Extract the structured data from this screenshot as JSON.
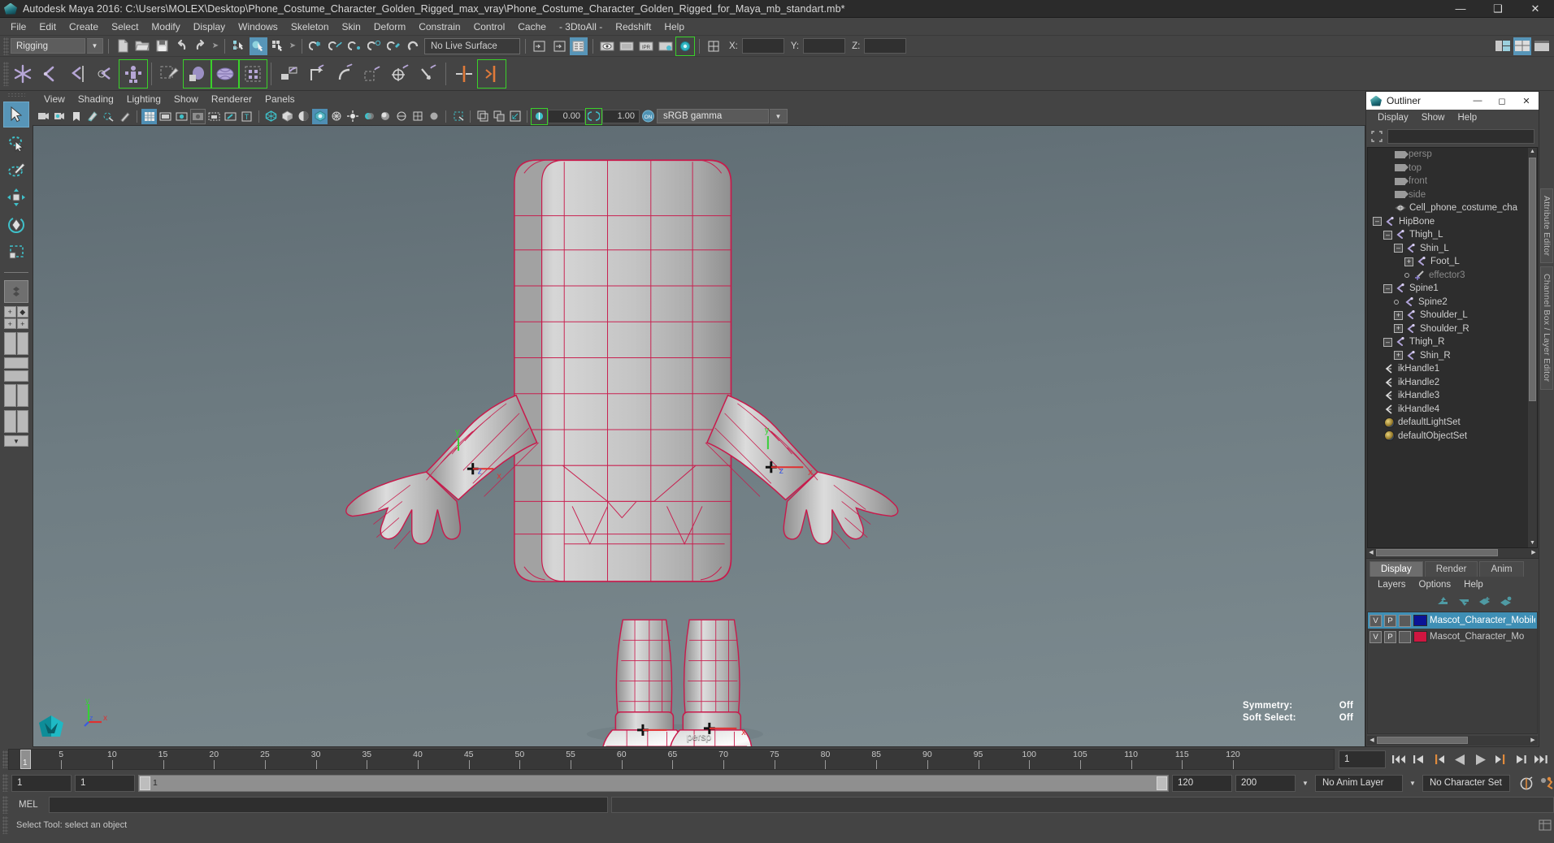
{
  "window": {
    "title": "Autodesk Maya 2016: C:\\Users\\MOLEX\\Desktop\\Phone_Costume_Character_Golden_Rigged_max_vray\\Phone_Costume_Character_Golden_Rigged_for_Maya_mb_standart.mb*",
    "minimize": "—",
    "maximize": "❑",
    "close": "✕"
  },
  "menubar": [
    "File",
    "Edit",
    "Create",
    "Select",
    "Modify",
    "Display",
    "Windows",
    "Skeleton",
    "Skin",
    "Deform",
    "Constrain",
    "Control",
    "Cache",
    "- 3DtoAll -",
    "Redshift",
    "Help"
  ],
  "statusline": {
    "menu_set": "Rigging",
    "live_surface": "No Live Surface",
    "coord_x_label": "X:",
    "coord_y_label": "Y:",
    "coord_z_label": "Z:",
    "coord_x": "",
    "coord_y": "",
    "coord_z": ""
  },
  "viewport_menu": [
    "View",
    "Shading",
    "Lighting",
    "Show",
    "Renderer",
    "Panels"
  ],
  "viewport_toolbar": {
    "exposure": "0.00",
    "gamma": "1.00",
    "color_profile": "sRGB gamma"
  },
  "viewport": {
    "camera_label": "persp",
    "hud": [
      {
        "label": "Symmetry:",
        "value": "Off"
      },
      {
        "label": "Soft Select:",
        "value": "Off"
      }
    ],
    "axis": {
      "x": "x",
      "y": "y",
      "z": "z"
    },
    "manipulator_labels": {
      "x": "x",
      "y": "y",
      "z": "z"
    },
    "colors": {
      "wireframe": "#c9194b",
      "surface": "#b9b9b9",
      "background_top": "#5e6b72",
      "background_bottom": "#7d8b90",
      "axis_x": "#e03030",
      "axis_y": "#36d036",
      "axis_z": "#3a5ae0"
    }
  },
  "outliner": {
    "title": "Outliner",
    "menus": [
      "Display",
      "Show",
      "Help"
    ],
    "search_value": "",
    "search_placeholder": "",
    "items": [
      {
        "label": "persp",
        "indent": 1,
        "icon": "camera-icon",
        "expander": "none",
        "dim": true
      },
      {
        "label": "top",
        "indent": 1,
        "icon": "camera-icon",
        "expander": "none",
        "dim": true
      },
      {
        "label": "front",
        "indent": 1,
        "icon": "camera-icon",
        "expander": "none",
        "dim": true
      },
      {
        "label": "side",
        "indent": 1,
        "icon": "camera-icon",
        "expander": "none",
        "dim": true
      },
      {
        "label": "Cell_phone_costume_cha",
        "indent": 1,
        "icon": "mesh-icon",
        "expander": "none",
        "dim": false
      },
      {
        "label": "HipBone",
        "indent": 0,
        "icon": "joint-icon",
        "expander": "minus",
        "dim": false
      },
      {
        "label": "Thigh_L",
        "indent": 1,
        "icon": "joint-icon",
        "expander": "minus",
        "dim": false
      },
      {
        "label": "Shin_L",
        "indent": 2,
        "icon": "joint-icon",
        "expander": "minus",
        "dim": false
      },
      {
        "label": "Foot_L",
        "indent": 3,
        "icon": "joint-icon",
        "expander": "plus",
        "dim": false
      },
      {
        "label": "effector3",
        "indent": 3,
        "icon": "effector-icon",
        "expander": "dot",
        "dim": true
      },
      {
        "label": "Spine1",
        "indent": 1,
        "icon": "joint-icon",
        "expander": "minus",
        "dim": false
      },
      {
        "label": "Spine2",
        "indent": 2,
        "icon": "joint-icon",
        "expander": "dot",
        "dim": false
      },
      {
        "label": "Shoulder_L",
        "indent": 2,
        "icon": "joint-icon",
        "expander": "plus",
        "dim": false
      },
      {
        "label": "Shoulder_R",
        "indent": 2,
        "icon": "joint-icon",
        "expander": "plus",
        "dim": false
      },
      {
        "label": "Thigh_R",
        "indent": 1,
        "icon": "joint-icon",
        "expander": "minus",
        "dim": false
      },
      {
        "label": "Shin_R",
        "indent": 2,
        "icon": "joint-icon",
        "expander": "plus",
        "dim": false
      },
      {
        "label": "ikHandle1",
        "indent": 0,
        "icon": "ik-icon",
        "expander": "none",
        "dim": false
      },
      {
        "label": "ikHandle2",
        "indent": 0,
        "icon": "ik-icon",
        "expander": "none",
        "dim": false
      },
      {
        "label": "ikHandle3",
        "indent": 0,
        "icon": "ik-icon",
        "expander": "none",
        "dim": false
      },
      {
        "label": "ikHandle4",
        "indent": 0,
        "icon": "ik-icon",
        "expander": "none",
        "dim": false
      },
      {
        "label": "defaultLightSet",
        "indent": 0,
        "icon": "set-icon",
        "expander": "none",
        "dim": false
      },
      {
        "label": "defaultObjectSet",
        "indent": 0,
        "icon": "set-icon",
        "expander": "none",
        "dim": false
      }
    ]
  },
  "layer_editor": {
    "tabs": [
      "Display",
      "Render",
      "Anim"
    ],
    "active_tab": "Display",
    "menus": [
      "Layers",
      "Options",
      "Help"
    ],
    "layers": [
      {
        "v": "V",
        "p": "P",
        "third": "",
        "color": "#0b1496",
        "name": "Mascot_Character_Mobile_P",
        "selected": true
      },
      {
        "v": "V",
        "p": "P",
        "third": "",
        "color": "#cf1640",
        "name": "Mascot_Character_Mo",
        "selected": false
      }
    ]
  },
  "right_rail": [
    "Attribute Editor",
    "Channel Box / Layer Editor"
  ],
  "timeline": {
    "start_frame": "1",
    "current_frame_marker": "1",
    "current_frame_field": "1",
    "ticks": [
      5,
      10,
      15,
      20,
      25,
      30,
      35,
      40,
      45,
      50,
      55,
      60,
      65,
      70,
      75,
      80,
      85,
      90,
      95,
      100,
      105,
      110,
      115,
      120
    ],
    "range_start": "1",
    "range_min": "1",
    "range_bar_label": "1",
    "range_bar_end": "120",
    "range_end": "120",
    "playback_end": "200",
    "anim_layer": "No Anim Layer",
    "character_set": "No Character Set"
  },
  "command_line": {
    "language": "MEL",
    "value": "",
    "placeholder": ""
  },
  "help_line": {
    "text": "Select Tool: select an object"
  }
}
